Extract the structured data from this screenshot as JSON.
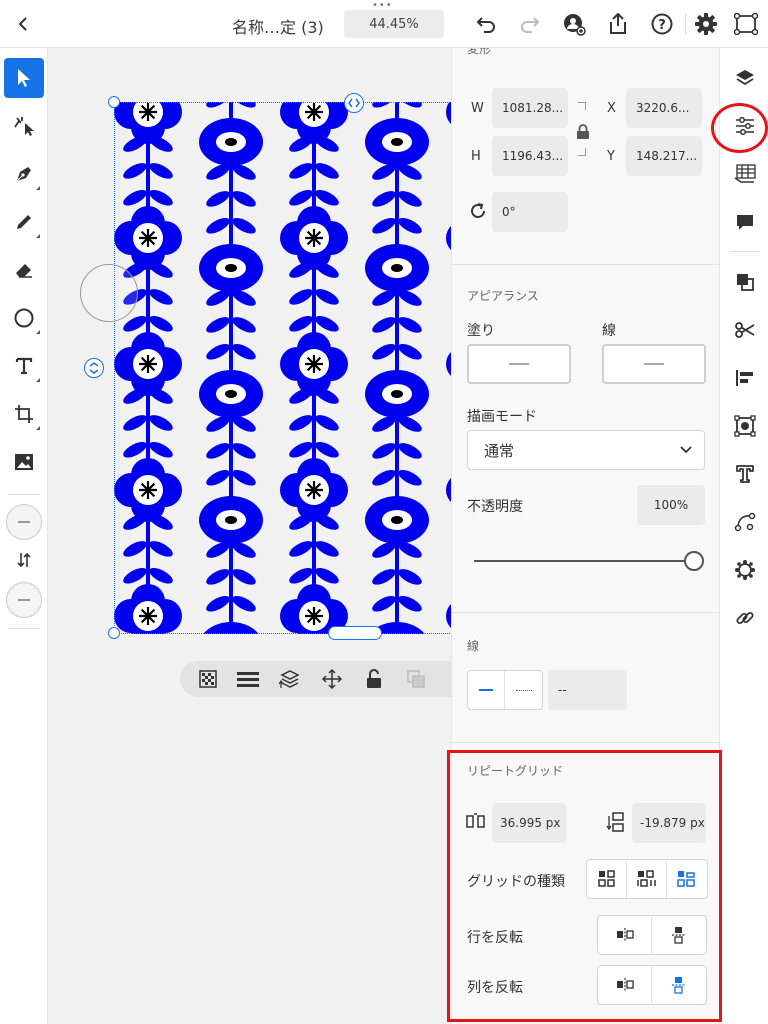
{
  "topbar": {
    "doc_title": "名称…定 (3)",
    "zoom": "44.45%"
  },
  "colors": {
    "accent": "#1473e6",
    "flower_blue": "#0000ee",
    "annotation_red": "#e61414"
  },
  "left_tools": [
    "select-tool",
    "direct-select-tool",
    "pen-tool",
    "pencil-tool",
    "eraser-tool",
    "ellipse-tool",
    "text-tool",
    "artboard-tool",
    "image-tool"
  ],
  "panel": {
    "transform": {
      "section_title": "変形",
      "w_label": "W",
      "w_value": "1081.28...",
      "h_label": "H",
      "h_value": "1196.43...",
      "x_label": "X",
      "x_value": "3220.6...",
      "y_label": "Y",
      "y_value": "148.217...",
      "rotation": "0°"
    },
    "appearance": {
      "section_title": "アピアランス",
      "fill_label": "塗り",
      "stroke_label": "線",
      "blend_label": "描画モード",
      "blend_value": "通常",
      "opacity_label": "不透明度",
      "opacity_value": "100%",
      "opacity": 1.0
    },
    "stroke": {
      "section_title": "線",
      "width_value": "--"
    },
    "repeat_grid": {
      "section_title": "リピートグリッド",
      "h_spacing": "36.995 px",
      "v_spacing": "-19.879 px",
      "grid_type_label": "グリッドの種類",
      "flip_row_label": "行を反転",
      "flip_col_label": "列を反転"
    }
  }
}
